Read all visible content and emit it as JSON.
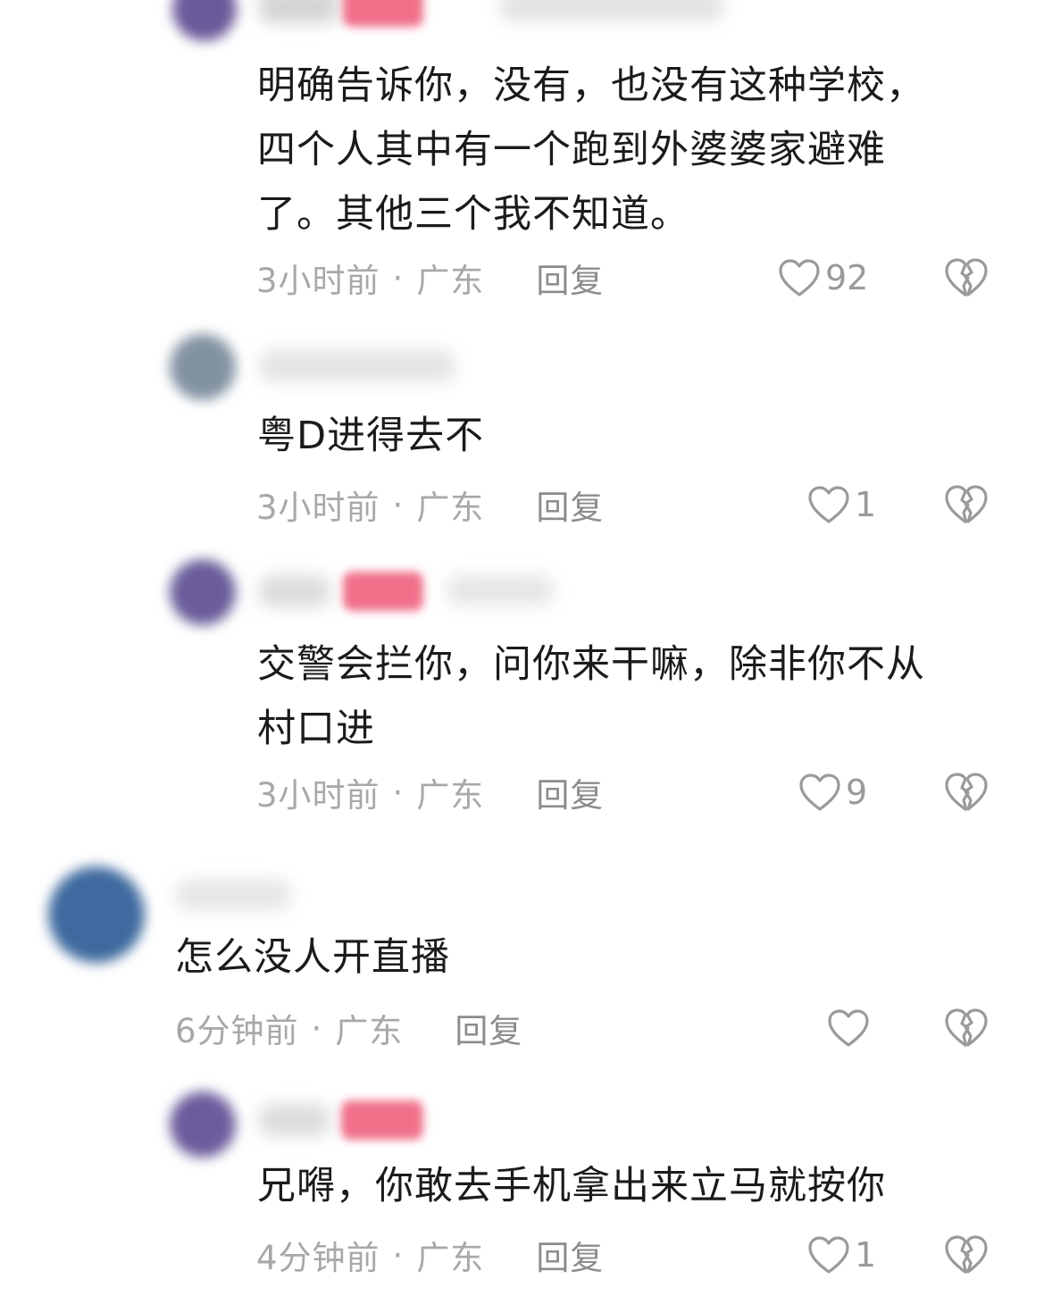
{
  "comments": [
    {
      "text_lines": [
        "明确告诉你，没有，也没有这种学校，",
        "四个人其中有一个跑到外婆婆家避难",
        "了。其他三个我不知道。"
      ],
      "time": "3小时前",
      "location": "广东",
      "separator": "·",
      "reply_label": "回复",
      "like_count": "92"
    },
    {
      "text_lines": [
        "粤D进得去不"
      ],
      "time": "3小时前",
      "location": "广东",
      "separator": "·",
      "reply_label": "回复",
      "like_count": "1"
    },
    {
      "text_lines": [
        "交警会拦你，问你来干嘛，除非你不从",
        "村口进"
      ],
      "time": "3小时前",
      "location": "广东",
      "separator": "·",
      "reply_label": "回复",
      "like_count": "9"
    },
    {
      "text_lines": [
        "怎么没人开直播"
      ],
      "time": "6分钟前",
      "location": "广东",
      "separator": "·",
      "reply_label": "回复",
      "like_count": ""
    },
    {
      "text_lines": [
        "兄嘚，你敢去手机拿出来立马就按你"
      ],
      "time": "4分钟前",
      "location": "广东",
      "separator": "·",
      "reply_label": "回复",
      "like_count": "1"
    }
  ],
  "icons": {
    "like": "heart-outline-icon",
    "dislike": "broken-heart-icon"
  },
  "colors": {
    "meta": "#a8a8a8",
    "author_tag": "#f0708a"
  }
}
